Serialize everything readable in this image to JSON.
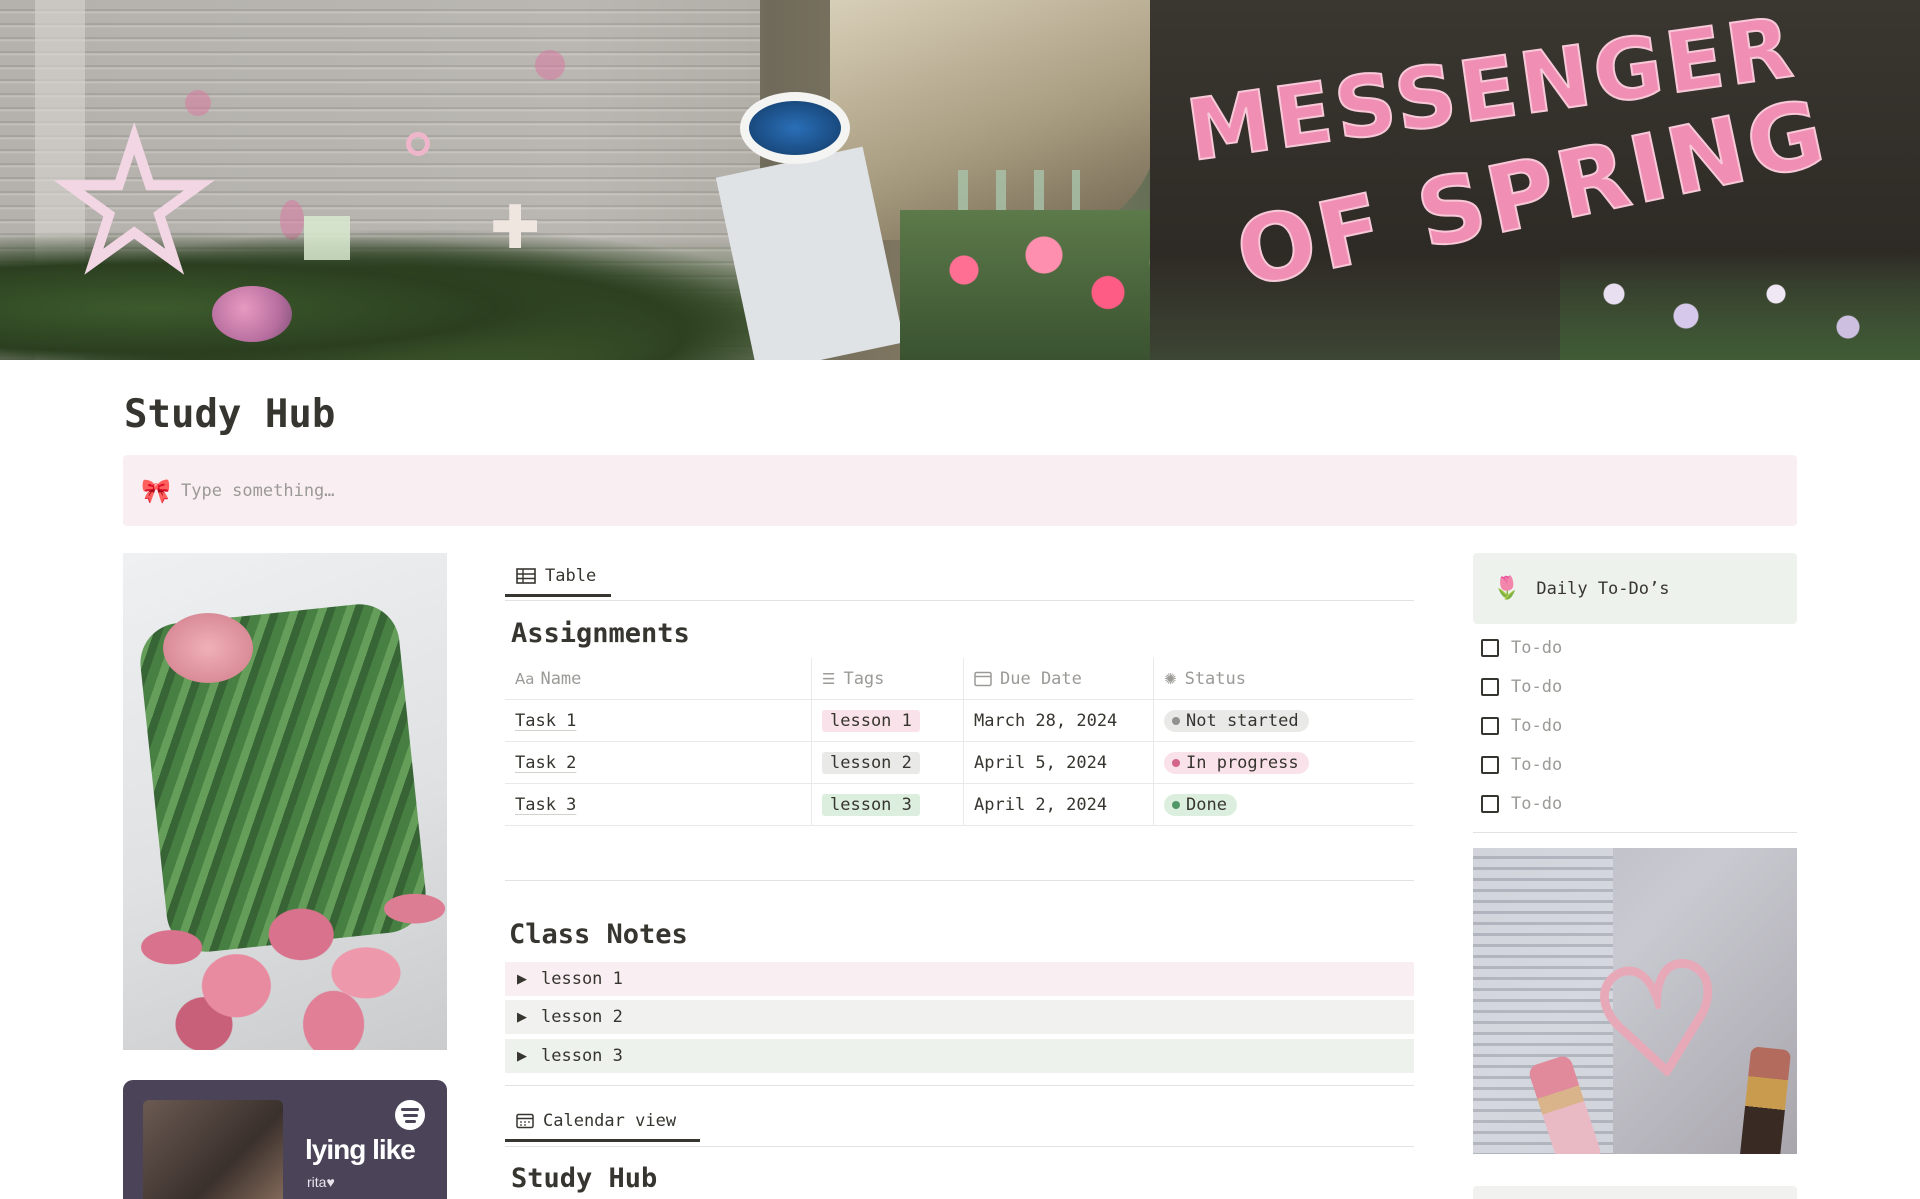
{
  "page": {
    "title": "Study Hub"
  },
  "callout": {
    "icon": "bow-icon",
    "placeholder": "Type something…"
  },
  "assignments": {
    "view_tab": "Table",
    "title": "Assignments",
    "columns": [
      {
        "label": "Name",
        "icon": "text-type-icon"
      },
      {
        "label": "Tags",
        "icon": "list-icon"
      },
      {
        "label": "Due Date",
        "icon": "calendar-icon"
      },
      {
        "label": "Status",
        "icon": "status-icon"
      }
    ],
    "rows": [
      {
        "name": "Task 1",
        "tag": "lesson 1",
        "tag_color": "#f9e2ea",
        "due": "March 28, 2024",
        "status": "Not started",
        "status_bg": "#e9e9e7",
        "status_dot": "#91918e"
      },
      {
        "name": "Task 2",
        "tag": "lesson 2",
        "tag_color": "#e9e9e7",
        "due": "April 5, 2024",
        "status": "In progress",
        "status_bg": "#f9e2ea",
        "status_dot": "#d3648a"
      },
      {
        "name": "Task 3",
        "tag": "lesson 3",
        "tag_color": "#dcefdf",
        "due": "April 2, 2024",
        "status": "Done",
        "status_bg": "#dcefdf",
        "status_dot": "#4f9768"
      }
    ]
  },
  "class_notes": {
    "title": "Class Notes",
    "items": [
      {
        "label": "lesson 1",
        "bg": "#f9eef2"
      },
      {
        "label": "lesson 2",
        "bg": "#f1f1ef"
      },
      {
        "label": "lesson 3",
        "bg": "#eef2ec"
      }
    ]
  },
  "calendar": {
    "view_tab": "Calendar view",
    "title": "Study Hub"
  },
  "todo": {
    "header": "Daily To-Do’s",
    "header_icon": "tulip-icon",
    "items": [
      "To-do",
      "To-do",
      "To-do",
      "To-do",
      "To-do"
    ]
  },
  "player": {
    "title": "lying like",
    "artist": "rita♥",
    "icon": "spotify-icon"
  },
  "cover": {
    "text_line1": "MESSENGER",
    "text_line2": "OF SPRING"
  },
  "colors": {
    "accent_pink": "#f9eef2",
    "accent_green": "#eef2ec",
    "text": "#37352f",
    "muted": "#9b9a97"
  }
}
